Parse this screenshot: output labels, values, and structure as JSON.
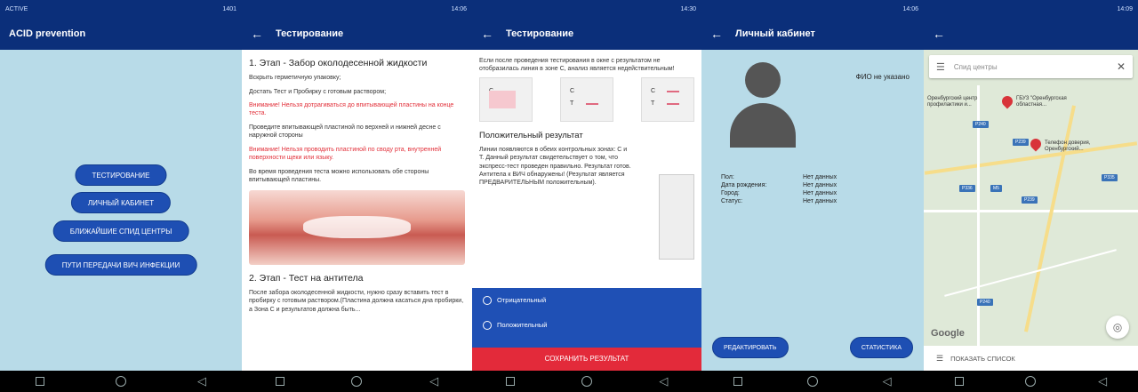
{
  "screen1": {
    "status_left": "ACTIVE",
    "status_right": "1401",
    "title": "ACID prevention",
    "buttons": [
      "ТЕСТИРОВАНИЕ",
      "ЛИЧНЫЙ КАБИНЕТ",
      "БЛИЖАЙШИЕ СПИД ЦЕНТРЫ",
      "ПУТИ ПЕРЕДАЧИ ВИЧ ИНФЕКЦИИ"
    ]
  },
  "screen2": {
    "status_right": "14:06",
    "title": "Тестирование",
    "step1_heading": "1. Этап - Забор околодесенной жидкости",
    "p1": "Вскрыть герметичную упаковку;",
    "p2": "Достать Тест и Пробирку с готовым раствором;",
    "warn1": "Внимание! Нельзя дотрагиваться до впитывающей пластины на конце теста.",
    "p3": "Проведите впитывающей пластиной по верхней и нижней десне с наружной стороны",
    "warn2": "Внимание! Нельзя проводить пластиной по своду рта, внутренней поверхности щеки или языку.",
    "p4": "Во время проведения теста можно использовать обе стороны впитывающей пластины.",
    "step2_heading": "2. Этап - Тест на антитела",
    "p5": "После забора околодесенной жидкости, нужно сразу вставить тест в пробирку с готовым раствором.(Пластина должна касаться дна пробирки, а Зона С и результатов должна быть..."
  },
  "screen3": {
    "status_right": "14:30",
    "title": "Тестирование",
    "intro": "Если после проведения тестирования в окне с результатом не отобразилась линия в зоне C, анализ является недействительным!",
    "strip_c": "C",
    "strip_t": "T",
    "positive_heading": "Положительный результат",
    "positive_text": "Линии появляются в обеих контрольных зонах: C и T. Данный результат свидетельствует о том, что экспресс-тест проведен правильно. Результат готов. Антитела к ВИЧ обнаружены! (Результат является ПРЕДВАРИТЕЛЬНЫМ положительным).",
    "option_negative": "Отрицательный",
    "option_positive": "Положительный",
    "save_label": "СОХРАНИТЬ РЕЗУЛЬТАТ"
  },
  "screen4": {
    "status_right": "14:06",
    "title": "Личный кабинет",
    "fio": "ФИО не указано",
    "rows": [
      {
        "k": "Пол:",
        "v": "Нет данных"
      },
      {
        "k": "Дата рождения:",
        "v": "Нет данных"
      },
      {
        "k": "Город:",
        "v": "Нет данных"
      },
      {
        "k": "Статус:",
        "v": "Нет данных"
      }
    ],
    "edit_label": "РЕДАКТИРОВАТЬ",
    "stats_label": "СТАТИСТИКА"
  },
  "screen5": {
    "status_right": "14:09",
    "search_placeholder": "Спид центры",
    "pin1_label": "ГБУЗ \"Оренбургская областная...",
    "pin1_prefix": "Оренбургский центр профилактики и...",
    "pin2_label": "Телефон доверия, Оренбургский...",
    "google": "Google",
    "list_label": "ПОКАЗАТЬ СПИСОК",
    "accent": "#0b2f7a"
  }
}
